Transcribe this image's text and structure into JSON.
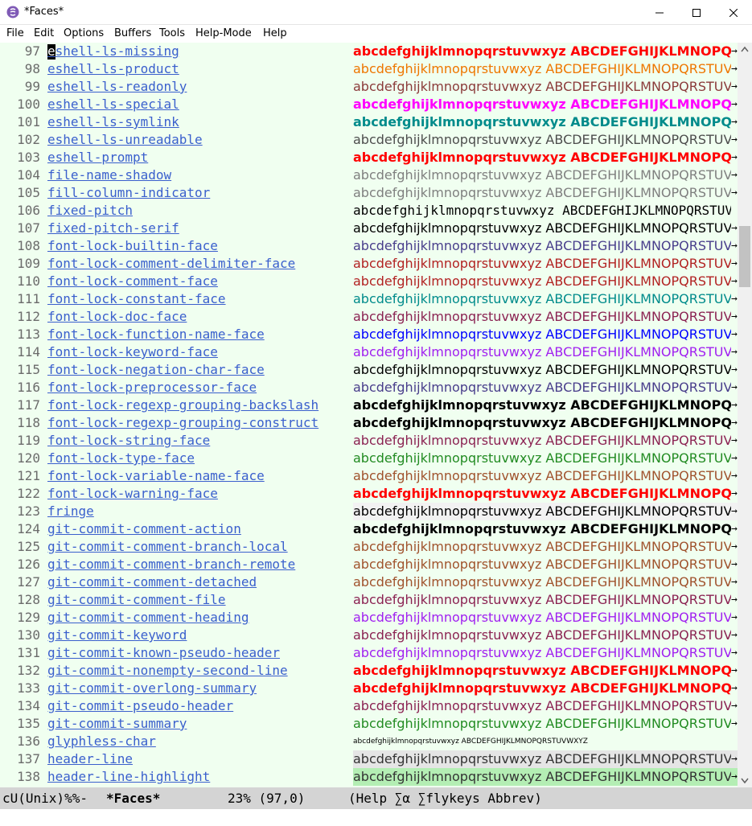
{
  "window": {
    "title": "*Faces*"
  },
  "menu": [
    "File",
    "Edit",
    "Options",
    "Buffers",
    "Tools",
    "Help-Mode",
    "Help"
  ],
  "sample_text": "abcdefghijklmnopqrstuvwxyz ABCDEFGHIJKLMNOPQRSTUVWXYZ",
  "truncation_mark": "→",
  "rows": [
    {
      "num": "97",
      "name": "eshell-ls-missing",
      "color": "#ff0000",
      "bold": true
    },
    {
      "num": "98",
      "name": "eshell-ls-product",
      "color": "#ee7600"
    },
    {
      "num": "99",
      "name": "eshell-ls-readonly",
      "color": "#8b3a3a"
    },
    {
      "num": "100",
      "name": "eshell-ls-special",
      "color": "#ff00ff",
      "bold": true
    },
    {
      "num": "101",
      "name": "eshell-ls-symlink",
      "color": "#008b8b",
      "bold": true
    },
    {
      "num": "102",
      "name": "eshell-ls-unreadable",
      "color": "#4d4d4d"
    },
    {
      "num": "103",
      "name": "eshell-prompt",
      "color": "#ff0000",
      "bold": true
    },
    {
      "num": "104",
      "name": "file-name-shadow",
      "color": "#7f7f7f"
    },
    {
      "num": "105",
      "name": "fill-column-indicator",
      "color": "#7f7f7f"
    },
    {
      "num": "106",
      "name": "fixed-pitch",
      "color": "#000000",
      "mono": true
    },
    {
      "num": "107",
      "name": "fixed-pitch-serif",
      "color": "#000000"
    },
    {
      "num": "108",
      "name": "font-lock-builtin-face",
      "color": "#483d8b"
    },
    {
      "num": "109",
      "name": "font-lock-comment-delimiter-face",
      "color": "#b22222"
    },
    {
      "num": "110",
      "name": "font-lock-comment-face",
      "color": "#b22222"
    },
    {
      "num": "111",
      "name": "font-lock-constant-face",
      "color": "#008b8b"
    },
    {
      "num": "112",
      "name": "font-lock-doc-face",
      "color": "#8b2252"
    },
    {
      "num": "113",
      "name": "font-lock-function-name-face",
      "color": "#0000ff"
    },
    {
      "num": "114",
      "name": "font-lock-keyword-face",
      "color": "#a020f0"
    },
    {
      "num": "115",
      "name": "font-lock-negation-char-face",
      "color": "#000000"
    },
    {
      "num": "116",
      "name": "font-lock-preprocessor-face",
      "color": "#483d8b"
    },
    {
      "num": "117",
      "name": "font-lock-regexp-grouping-backslash",
      "color": "#000000",
      "bold": true
    },
    {
      "num": "118",
      "name": "font-lock-regexp-grouping-construct",
      "color": "#000000",
      "bold": true
    },
    {
      "num": "119",
      "name": "font-lock-string-face",
      "color": "#8b2252"
    },
    {
      "num": "120",
      "name": "font-lock-type-face",
      "color": "#228b22"
    },
    {
      "num": "121",
      "name": "font-lock-variable-name-face",
      "color": "#a0522d"
    },
    {
      "num": "122",
      "name": "font-lock-warning-face",
      "color": "#ff0000",
      "bold": true
    },
    {
      "num": "123",
      "name": "fringe",
      "color": "#000000",
      "bg": "#f2f2f2"
    },
    {
      "num": "124",
      "name": "git-commit-comment-action",
      "color": "#000000",
      "bold": true
    },
    {
      "num": "125",
      "name": "git-commit-comment-branch-local",
      "color": "#a0522d"
    },
    {
      "num": "126",
      "name": "git-commit-comment-branch-remote",
      "color": "#a0522d"
    },
    {
      "num": "127",
      "name": "git-commit-comment-detached",
      "color": "#a0522d"
    },
    {
      "num": "128",
      "name": "git-commit-comment-file",
      "color": "#8b2252"
    },
    {
      "num": "129",
      "name": "git-commit-comment-heading",
      "color": "#a020f0"
    },
    {
      "num": "130",
      "name": "git-commit-keyword",
      "color": "#8b2252"
    },
    {
      "num": "131",
      "name": "git-commit-known-pseudo-header",
      "color": "#a020f0"
    },
    {
      "num": "132",
      "name": "git-commit-nonempty-second-line",
      "color": "#ff0000",
      "bold": true
    },
    {
      "num": "133",
      "name": "git-commit-overlong-summary",
      "color": "#ff0000",
      "bold": true
    },
    {
      "num": "134",
      "name": "git-commit-pseudo-header",
      "color": "#8b2252"
    },
    {
      "num": "135",
      "name": "git-commit-summary",
      "color": "#228b22"
    },
    {
      "num": "136",
      "name": "glyphless-char",
      "color": "#000000",
      "small": true
    },
    {
      "num": "137",
      "name": "header-line",
      "color": "#333333",
      "bg": "#e5e5e5"
    },
    {
      "num": "138",
      "name": "header-line-highlight",
      "color": "#333333",
      "bg": "#b4eeb4"
    }
  ],
  "modeline": {
    "status": "cU(Unix)%%-",
    "buffer": "*Faces*",
    "position": "23% (97,0)",
    "modes": "(Help ∑α ∑flykeys Abbrev)"
  },
  "colors": {
    "buffer_bg": "#f0fff0",
    "link": "#3a5fcd",
    "modeline_bg": "#d4d4d4"
  }
}
